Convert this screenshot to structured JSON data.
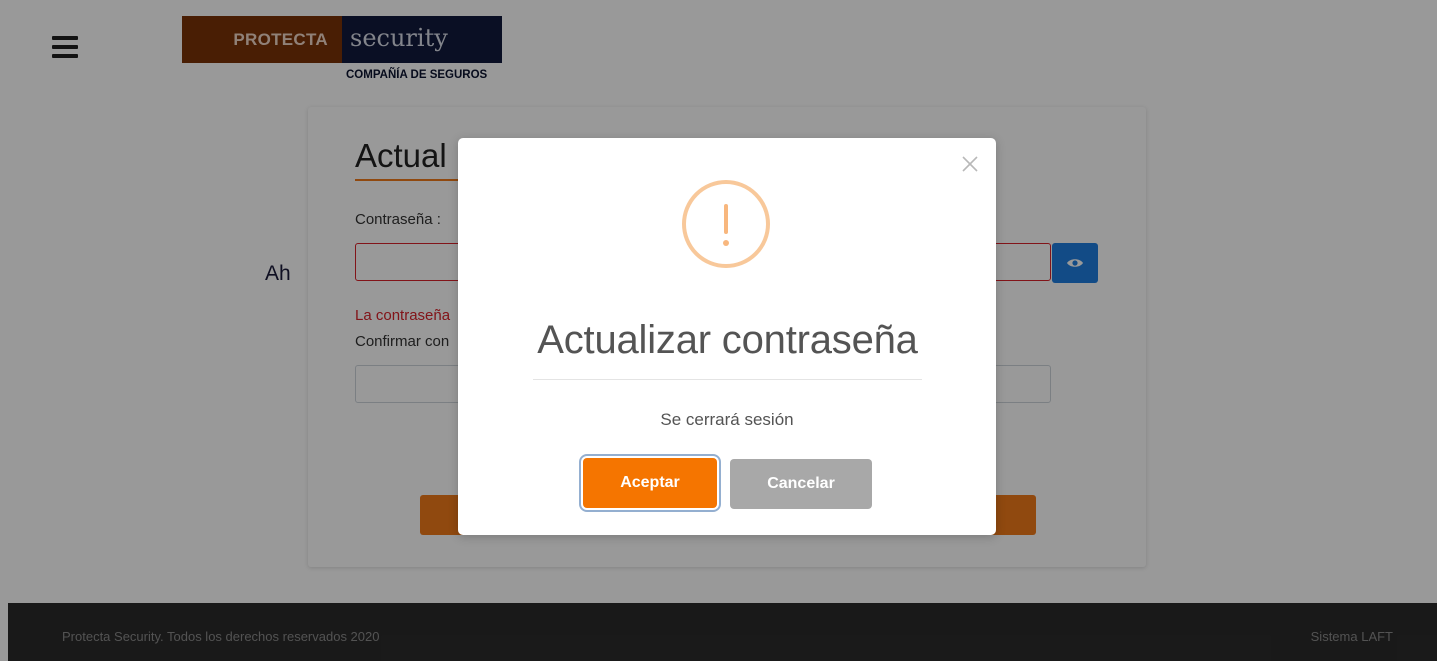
{
  "header": {
    "logo_left": "PROTECTA",
    "logo_right": "security",
    "logo_sub": "COMPAÑÍA DE SEGUROS"
  },
  "page": {
    "ahora_text": "Ah",
    "card_title": "Actual",
    "password_label": "Contraseña :",
    "password_error": "La contraseña",
    "confirm_label": "Confirmar con"
  },
  "modal": {
    "title": "Actualizar contraseña",
    "message": "Se cerrará sesión",
    "confirm_label": "Aceptar",
    "cancel_label": "Cancelar"
  },
  "footer": {
    "copyright": "Protecta Security. Todos los derechos reservados 2020",
    "system": "Sistema LAFT"
  },
  "colors": {
    "accent": "#f57500",
    "eye_button": "#1e7ee0",
    "error": "#d9222a",
    "cancel": "#a8a8a8"
  },
  "icons": {
    "menu": "hamburger-menu-icon",
    "eye": "eye-icon",
    "close": "close-icon",
    "warning": "warning-exclamation-icon"
  }
}
